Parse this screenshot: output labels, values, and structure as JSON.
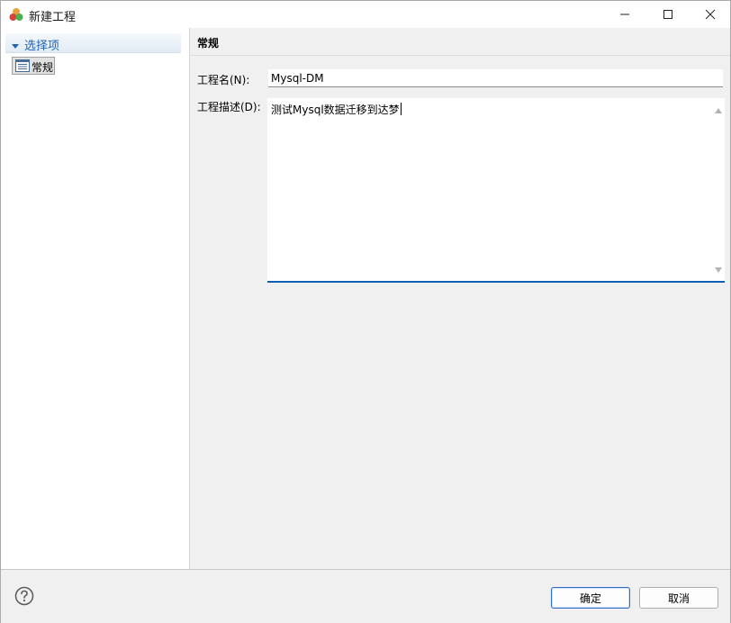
{
  "window": {
    "title": "新建工程"
  },
  "sidebar": {
    "header_label": "选择项",
    "items": [
      {
        "label": "常规",
        "selected": true
      }
    ]
  },
  "main": {
    "section_title": "常规",
    "name_label": "工程名(N):",
    "name_value": "Mysql-DM",
    "desc_label": "工程描述(D):",
    "desc_value": "测试Mysql数据迁移到达梦"
  },
  "footer": {
    "ok_label": "确定",
    "cancel_label": "取消"
  },
  "colors": {
    "accent": "#0a5fb4",
    "tree_header_text": "#1d64b4",
    "panel_bg": "#f0f0f0"
  },
  "icons": [
    "app-icon",
    "minimize-icon",
    "maximize-icon",
    "close-icon",
    "expand-arrow-icon",
    "list-page-icon",
    "help-icon",
    "scroll-up-icon",
    "scroll-down-icon"
  ]
}
